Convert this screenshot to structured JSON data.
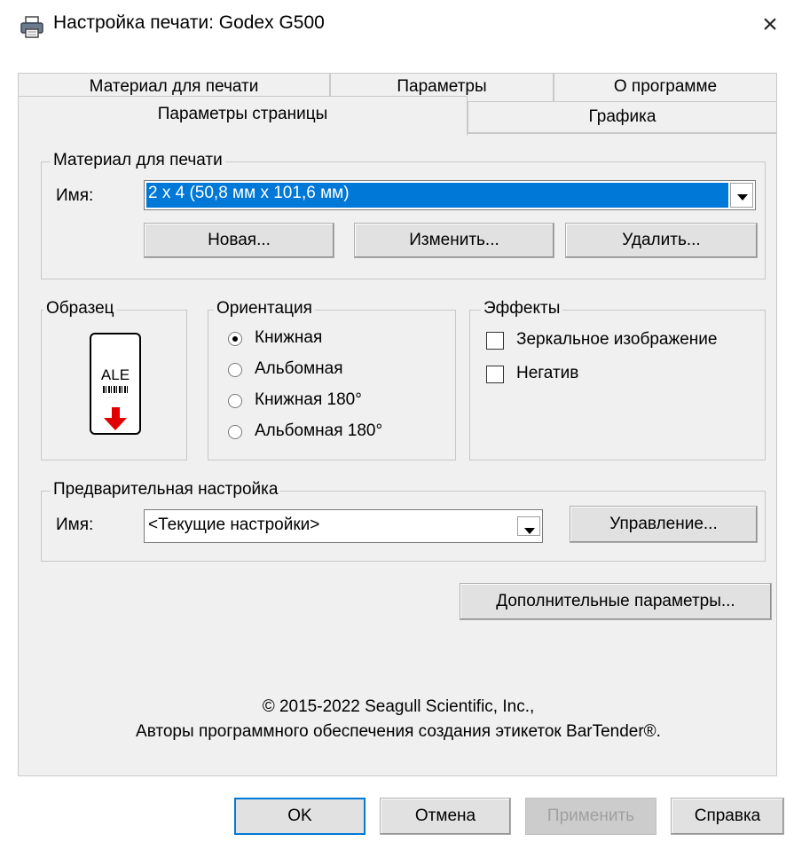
{
  "window": {
    "title": "Настройка печати: Godex G500",
    "close_glyph": "×"
  },
  "tabs": {
    "back_row": [
      "Материал для печати",
      "Параметры",
      "О программе"
    ],
    "front_row": [
      "Параметры страницы",
      "Графика"
    ],
    "active": "Параметры страницы"
  },
  "media": {
    "group_title": "Материал для печати",
    "name_label": "Имя:",
    "name_value": "2 x 4 (50,8 мм x 101,6 мм)",
    "buttons": [
      "Новая...",
      "Изменить...",
      "Удалить..."
    ]
  },
  "sample": {
    "group_title": "Образец",
    "label_text": "ALE"
  },
  "orientation": {
    "group_title": "Ориентация",
    "options": [
      "Книжная",
      "Альбомная",
      "Книжная 180°",
      "Альбомная 180°"
    ],
    "selected": "Книжная"
  },
  "effects": {
    "group_title": "Эффекты",
    "options": [
      "Зеркальное изображение",
      "Негатив"
    ],
    "checked": []
  },
  "preset": {
    "group_title": "Предварительная настройка",
    "name_label": "Имя:",
    "name_value": "<Текущие настройки>",
    "manage_button": "Управление..."
  },
  "advanced_button": "Дополнительные параметры...",
  "copyright": {
    "line1": "© 2015-2022 Seagull Scientific, Inc.,",
    "line2": "Авторы программного обеспечения создания этикеток BarTender®."
  },
  "footer": {
    "ok": "OK",
    "cancel": "Отмена",
    "apply": "Применить",
    "help": "Справка"
  },
  "colors": {
    "selection": "#0078d7",
    "arrow": "#e00000",
    "panel": "#f0f0f0"
  },
  "icons": {
    "title": "printer-icon",
    "dropdown": "chevron-down-icon",
    "close": "close-icon"
  }
}
